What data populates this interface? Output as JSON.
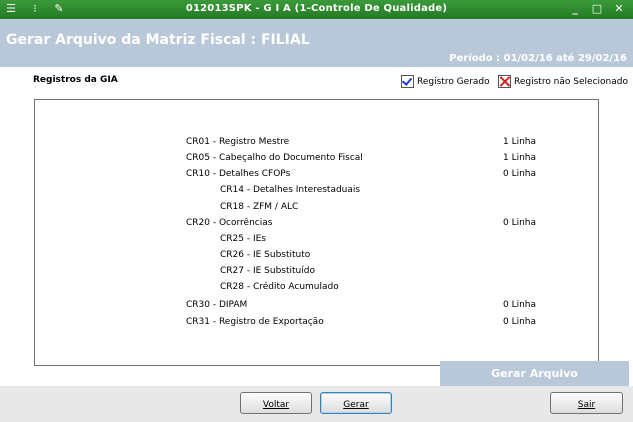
{
  "window": {
    "title": "012013SPK - G I A (1-Controle De Qualidade)",
    "minimize": "_",
    "maximize": "□",
    "close": "✕"
  },
  "header": {
    "title": "Gerar Arquivo da Matriz Fiscal : FILIAL",
    "period": "Período : 01/02/16 até 29/02/16"
  },
  "section": {
    "title": "Registros da GIA",
    "legend_generated": "Registro Gerado",
    "legend_not_selected": "Registro não Selecionado"
  },
  "records": [
    {
      "code": "CR01 - Registro Mestre",
      "lines": "1 Linha",
      "indent": false
    },
    {
      "code": "CR05 - Cabeçalho do Documento Fiscal",
      "lines": "1 Linha",
      "indent": false
    },
    {
      "code": "CR10 - Detalhes CFOPs",
      "lines": "0 Linha",
      "indent": false
    },
    {
      "code": "CR14 - Detalhes Interestaduais",
      "lines": "",
      "indent": true
    },
    {
      "code": "CR18 - ZFM / ALC",
      "lines": "",
      "indent": true
    },
    {
      "code": "CR20 - Ocorrências",
      "lines": "0 Linha",
      "indent": false
    },
    {
      "code": "CR25 - IEs",
      "lines": "",
      "indent": true
    },
    {
      "code": "CR26 - IE Substituto",
      "lines": "",
      "indent": true
    },
    {
      "code": "CR27 - IE Substituído",
      "lines": "",
      "indent": true
    },
    {
      "code": "CR28 - Crédito Acumulado",
      "lines": "",
      "indent": true
    },
    {
      "code": "CR30 - DIPAM",
      "lines": "0 Linha",
      "indent": false
    },
    {
      "code": "CR31 - Registro de Exportação",
      "lines": "0 Linha",
      "indent": false
    }
  ],
  "actions": {
    "generate_file": "Gerar Arquivo",
    "back": "Voltar",
    "generate": "Gerar",
    "exit": "Sair"
  },
  "icons": [
    "menu-icon",
    "traffic-light-icon",
    "wrench-icon"
  ],
  "colors": {
    "titlebar": "#2e8b2e",
    "header": "#b8c8d8",
    "check": "#1a3fd0",
    "cross": "#d02020"
  }
}
